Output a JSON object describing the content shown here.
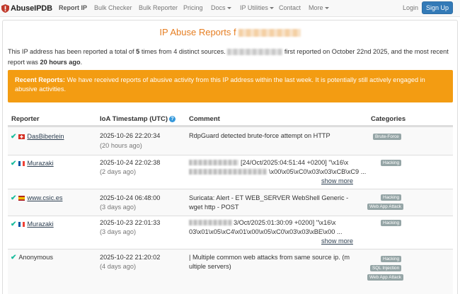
{
  "navbar": {
    "brand": "AbuseIPDB",
    "items": [
      {
        "label": "Report IP",
        "active": true
      },
      {
        "label": "Bulk Checker"
      },
      {
        "label": "Bulk Reporter"
      },
      {
        "label": "Pricing"
      },
      {
        "label": "Docs",
        "dropdown": true
      },
      {
        "label": "IP Utilities",
        "dropdown": true
      },
      {
        "label": "Contact"
      },
      {
        "label": "More",
        "dropdown": true
      }
    ],
    "login": "Login",
    "signup": "Sign Up"
  },
  "page": {
    "title": "IP Abuse Reports f",
    "summary_1": "This IP address has been reported a total of ",
    "summary_count": "5",
    "summary_2": " times from 4 distinct sources. ",
    "summary_3": " first reported on October 22nd 2025, and the most recent report was ",
    "summary_recent": "20 hours ago",
    "summary_4": "."
  },
  "alert": {
    "heading": "Recent Reports:",
    "text": " We have received reports of abusive activity from this IP address within the last week. It is potentially still actively engaged in abusive activities."
  },
  "table": {
    "headers": {
      "reporter": "Reporter",
      "timestamp": "IoA Timestamp (UTC)",
      "comment": "Comment",
      "categories": "Categories"
    },
    "show_more": "show more",
    "rows": [
      {
        "reporter": "DasBiberlein",
        "flag": "ch",
        "timestamp": "2025-10-26 22:20:34",
        "ago": "(20 hours ago)",
        "comment_1": "RdpGuard detected brute-force attempt on HTTP",
        "comment_2": "",
        "categories": [
          "Brute-Force"
        ]
      },
      {
        "reporter": "Murazaki",
        "flag": "fr",
        "timestamp": "2025-10-24 22:02:38",
        "ago": "(2 days ago)",
        "comment_1": "[24/Oct/2025:04:51:44 +0200] \"\\x16\\x",
        "comment_2": "\\x00\\x05\\xC0\\x03\\x03\\xCB\\xC9 ...",
        "categories": [
          "Hacking"
        ]
      },
      {
        "reporter": "www.csic.es",
        "flag": "es",
        "timestamp": "2025-10-24 06:48:00",
        "ago": "(3 days ago)",
        "comment_1": "Suricata: Alert - ET WEB_SERVER WebShell Generic -",
        "comment_2": "wget http - POST",
        "categories": [
          "Hacking",
          "Web App Attack"
        ]
      },
      {
        "reporter": "Murazaki",
        "flag": "fr",
        "timestamp": "2025-10-23 22:01:33",
        "ago": "(3 days ago)",
        "comment_1": "3/Oct/2025:01:30:09 +0200] \"\\x16\\x",
        "comment_2": "03\\x01\\x05\\xC4\\x01\\x00\\x05\\xC0\\x03\\x03\\xBE\\x00 ...",
        "categories": [
          "Hacking"
        ]
      },
      {
        "reporter": "Anonymous",
        "flag": "",
        "timestamp": "2025-10-22 21:20:02",
        "ago": "(4 days ago)",
        "comment_1": "| Multiple common web attacks from same source ip. (m",
        "comment_2": "ultiple servers)",
        "categories": [
          "Hacking",
          "SQL Injection",
          "Web App Attack"
        ]
      }
    ]
  },
  "colors": {
    "accent_orange": "#e67e22",
    "alert_bg": "#f39c12",
    "primary": "#337ab7",
    "check": "#18bc9c",
    "badge": "#95a5a6"
  }
}
